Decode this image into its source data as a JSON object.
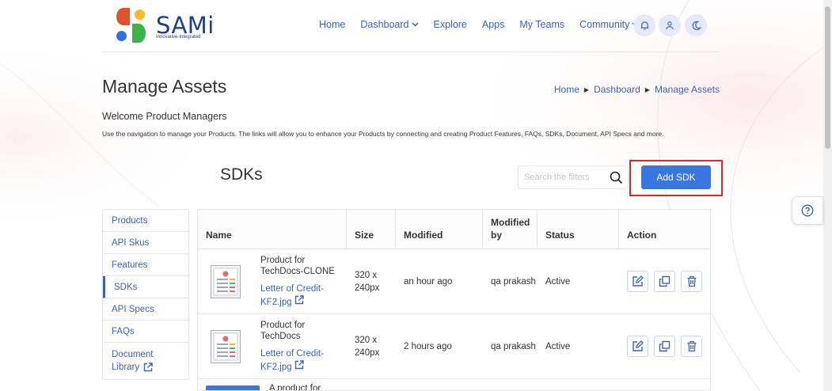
{
  "brand": {
    "name": "SAMi",
    "tagline": "Innovative-Integrated"
  },
  "nav": {
    "items": [
      {
        "label": "Home",
        "has_dropdown": false
      },
      {
        "label": "Dashboard",
        "has_dropdown": true
      },
      {
        "label": "Explore",
        "has_dropdown": false
      },
      {
        "label": "Apps",
        "has_dropdown": false
      },
      {
        "label": "My Teams",
        "has_dropdown": false
      },
      {
        "label": "Community",
        "has_dropdown": true
      }
    ],
    "icons": [
      "bell-icon",
      "user-icon",
      "moon-icon"
    ]
  },
  "page": {
    "title": "Manage Assets",
    "breadcrumb": [
      "Home",
      "Dashboard",
      "Manage Assets"
    ],
    "welcome": "Welcome Product Managers",
    "description": "Use the navigation to manage your Products. The links will allow you to enhance your Products by connecting and creating Product Features, FAQs, SDKs, Document, API Specs and more."
  },
  "section": {
    "title": "SDKs",
    "search_placeholder": "Search the filters",
    "add_button": "Add SDK"
  },
  "sidebar": {
    "items": [
      {
        "label": "Products",
        "active": false
      },
      {
        "label": "API Skus",
        "active": false
      },
      {
        "label": "Features",
        "active": false
      },
      {
        "label": "SDKs",
        "active": true
      },
      {
        "label": "API Specs",
        "active": false
      },
      {
        "label": "FAQs",
        "active": false
      },
      {
        "label": "Document Library",
        "active": false
      }
    ]
  },
  "table": {
    "headers": {
      "name": "Name",
      "size": "Size",
      "modified": "Modified",
      "modified_by": "Modified by",
      "status": "Status",
      "action": "Action"
    },
    "rows": [
      {
        "product": "Product for TechDocs-CLONE",
        "file": "Letter of Credit-KF2.jpg",
        "size": "320 x 240px",
        "modified": "an hour ago",
        "modified_by": "qa prakash",
        "status": "Active"
      },
      {
        "product": "Product for TechDocs",
        "file": "Letter of Credit-KF2.jpg",
        "size": "320 x 240px",
        "modified": "2 hours ago",
        "modified_by": "qa prakash",
        "status": "Active"
      }
    ],
    "partial_row": {
      "product": "A product for"
    }
  },
  "colors": {
    "accent": "#3a76e0",
    "link": "#3b62b5",
    "highlight": "#d42a2a",
    "brand_text": "#1e3f8a"
  }
}
